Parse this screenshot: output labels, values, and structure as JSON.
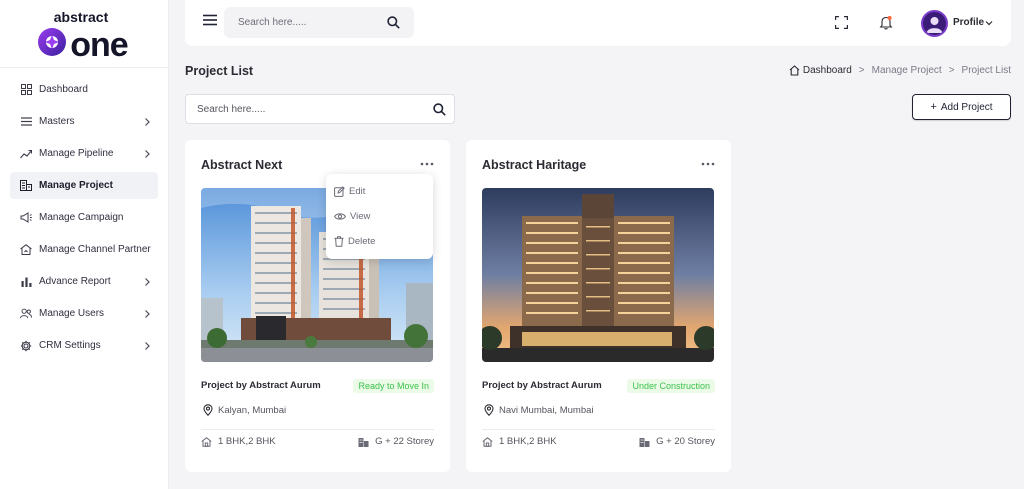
{
  "brand": {
    "top": "abstract",
    "bottom": "one"
  },
  "sidebar": {
    "items": [
      {
        "label": "Dashboard",
        "icon": "dashboard-icon",
        "has_children": false,
        "active": false
      },
      {
        "label": "Masters",
        "icon": "list-icon",
        "has_children": true,
        "active": false
      },
      {
        "label": "Manage Pipeline",
        "icon": "pipeline-icon",
        "has_children": true,
        "active": false
      },
      {
        "label": "Manage Project",
        "icon": "building-icon",
        "has_children": false,
        "active": true
      },
      {
        "label": "Manage Campaign",
        "icon": "megaphone-icon",
        "has_children": false,
        "active": false
      },
      {
        "label": "Manage Channel Partner",
        "icon": "partner-icon",
        "has_children": false,
        "active": false
      },
      {
        "label": "Advance Report",
        "icon": "bar-chart-icon",
        "has_children": true,
        "active": false
      },
      {
        "label": "Manage Users",
        "icon": "users-icon",
        "has_children": true,
        "active": false
      },
      {
        "label": "CRM Settings",
        "icon": "gear-icon",
        "has_children": true,
        "active": false
      }
    ]
  },
  "topbar": {
    "search_placeholder": "Search here.....",
    "profile_label": "Profile"
  },
  "page": {
    "title": "Project List",
    "breadcrumb": [
      "Dashboard",
      "Manage Project",
      "Project List"
    ],
    "search_placeholder": "Search here.....",
    "add_button": "Add Project"
  },
  "projects": [
    {
      "name": "Abstract Next",
      "builder": "Project by Abstract Aurum",
      "status": "Ready to Move In",
      "location": "Kalyan, Mumbai",
      "bhk": "1 BHK,2 BHK",
      "floors": "G + 22 Storey"
    },
    {
      "name": "Abstract Haritage",
      "builder": "Project by Abstract Aurum",
      "status": "Under Construction",
      "location": "Navi Mumbai, Mumbai",
      "bhk": "1 BHK,2 BHK",
      "floors": "G + 20 Storey"
    }
  ],
  "card_menu": {
    "items": [
      "Edit",
      "View",
      "Delete"
    ]
  },
  "colors": {
    "accent_dark": "#1f2233",
    "status_green": "#3cc24a",
    "status_bg": "#ebfbe8",
    "logo_purple": "#6b2fd6"
  }
}
